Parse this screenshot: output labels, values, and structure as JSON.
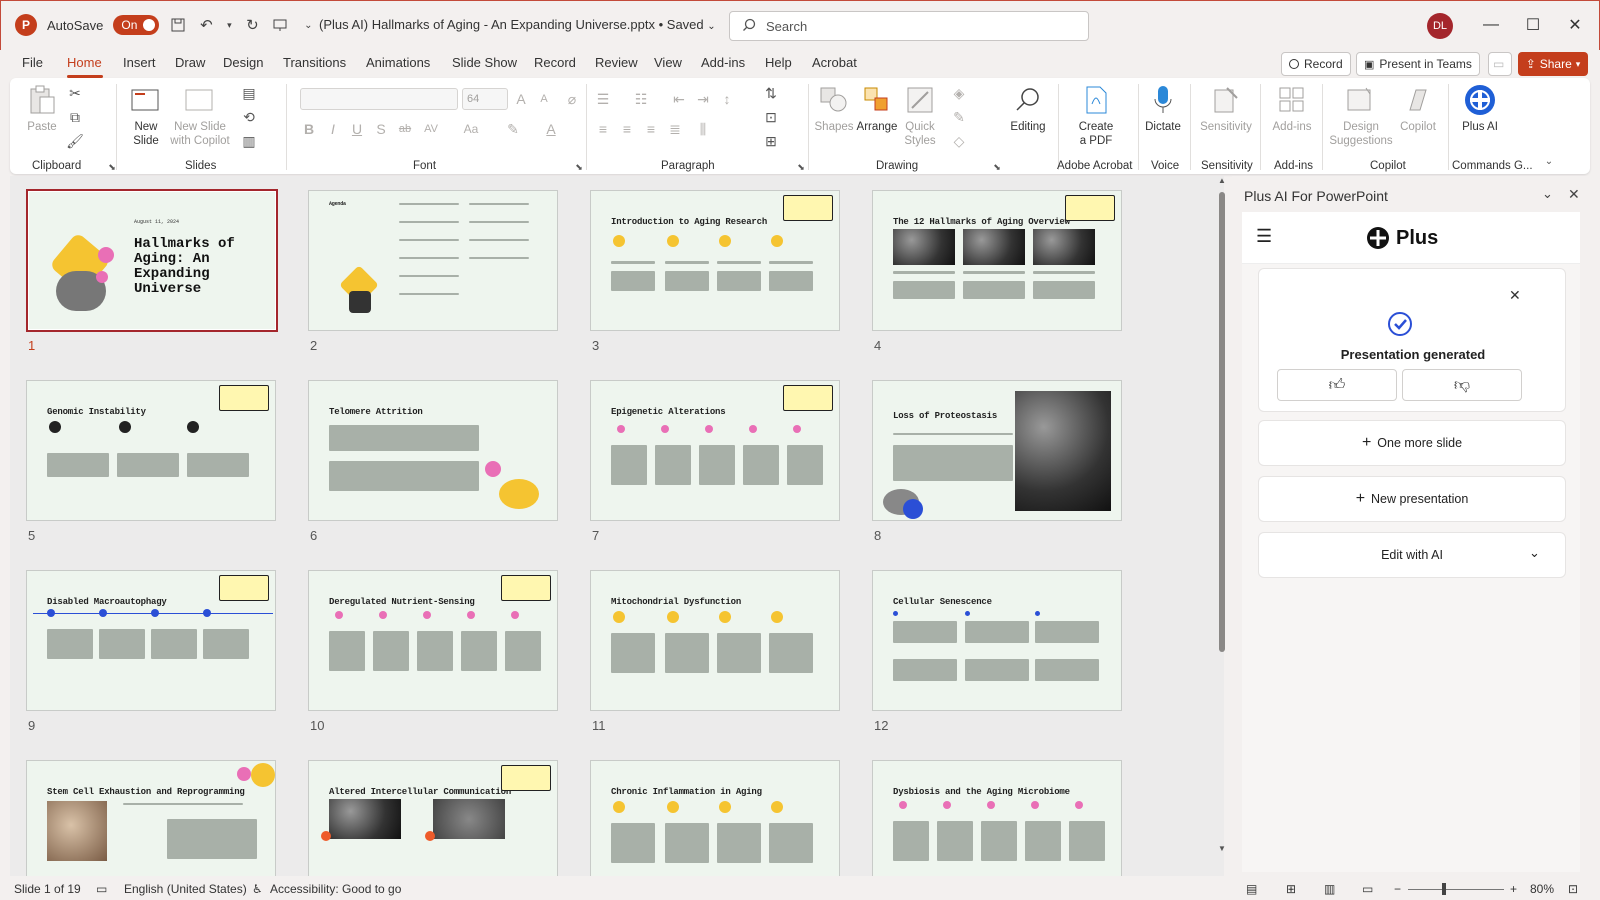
{
  "app": {
    "logo_letter": "P",
    "autosave_label": "AutoSave",
    "autosave_state": "On",
    "document_title": "(Plus AI) Hallmarks of Aging - An Expanding Universe.pptx • Saved",
    "search_placeholder": "Search",
    "user_initials": "DL"
  },
  "menu": {
    "tabs": [
      "File",
      "Home",
      "Insert",
      "Draw",
      "Design",
      "Transitions",
      "Animations",
      "Slide Show",
      "Record",
      "Review",
      "View",
      "Add-ins",
      "Help",
      "Acrobat"
    ],
    "active_tab": "Home",
    "record_label": "Record",
    "present_teams_label": "Present in Teams",
    "share_label": "Share"
  },
  "ribbon": {
    "clipboard": {
      "paste": "Paste",
      "label": "Clipboard"
    },
    "slides": {
      "new_slide": "New Slide",
      "new_slide_copilot": "New Slide with Copilot",
      "label": "Slides"
    },
    "font": {
      "size": "64",
      "label": "Font"
    },
    "paragraph": {
      "label": "Paragraph"
    },
    "drawing": {
      "shapes": "Shapes",
      "arrange": "Arrange",
      "quick_styles": "Quick Styles",
      "label": "Drawing"
    },
    "editing": {
      "label": "Editing"
    },
    "adobe": {
      "create_pdf": "Create a PDF",
      "label": "Adobe Acrobat"
    },
    "voice": {
      "dictate": "Dictate",
      "label": "Voice"
    },
    "sensitivity": {
      "btn": "Sensitivity",
      "label": "Sensitivity"
    },
    "addins": {
      "btn": "Add-ins",
      "label": "Add-ins"
    },
    "copilot": {
      "design": "Design Suggestions",
      "copilot": "Copilot",
      "label": "Copilot"
    },
    "commands": {
      "plus_ai": "Plus AI",
      "label": "Commands G..."
    }
  },
  "slides": [
    {
      "n": "1",
      "title": "Hallmarks of Aging: An Expanding Universe",
      "date": "August 11, 2024"
    },
    {
      "n": "2",
      "title": "Agenda"
    },
    {
      "n": "3",
      "title": "Introduction to Aging Research"
    },
    {
      "n": "4",
      "title": "The 12 Hallmarks of Aging Overview"
    },
    {
      "n": "5",
      "title": "Genomic Instability"
    },
    {
      "n": "6",
      "title": "Telomere Attrition"
    },
    {
      "n": "7",
      "title": "Epigenetic Alterations"
    },
    {
      "n": "8",
      "title": "Loss of Proteostasis"
    },
    {
      "n": "9",
      "title": "Disabled Macroautophagy"
    },
    {
      "n": "10",
      "title": "Deregulated Nutrient-Sensing"
    },
    {
      "n": "11",
      "title": "Mitochondrial Dysfunction"
    },
    {
      "n": "12",
      "title": "Cellular Senescence"
    },
    {
      "n": "",
      "title": "Stem Cell Exhaustion and Reprogramming"
    },
    {
      "n": "",
      "title": "Altered Intercellular Communication"
    },
    {
      "n": "",
      "title": "Chronic Inflammation in Aging"
    },
    {
      "n": "",
      "title": "Dysbiosis and the Aging Microbiome"
    }
  ],
  "panel": {
    "title": "Plus AI For PowerPoint",
    "brand": "Plus",
    "status": "Presentation generated",
    "one_more_slide": "One more slide",
    "new_presentation": "New presentation",
    "edit_with_ai": "Edit with AI"
  },
  "status": {
    "slide_of": "Slide 1 of 19",
    "language": "English (United States)",
    "accessibility": "Accessibility: Good to go",
    "zoom": "80%"
  },
  "colors": {
    "accent": "#c43e1c",
    "selected_border": "#a4262c",
    "slide_bg": "#eef5ee"
  }
}
